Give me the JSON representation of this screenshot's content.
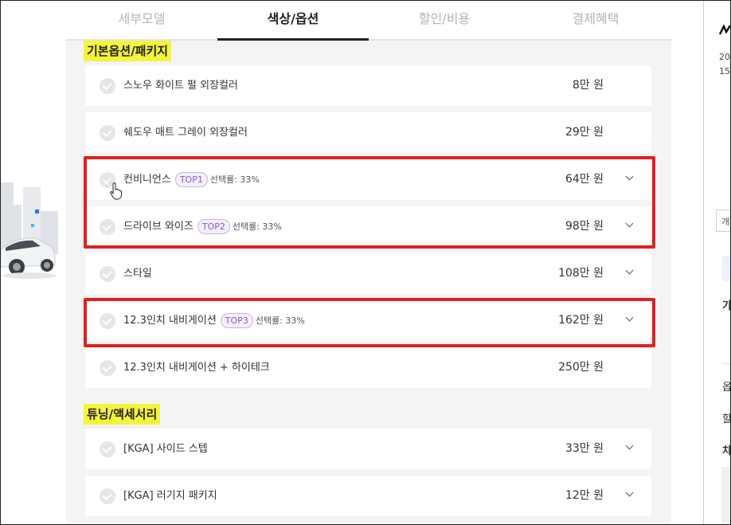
{
  "tabs": [
    {
      "label": "세부모델",
      "active": false
    },
    {
      "label": "색상/옵션",
      "active": true
    },
    {
      "label": "할인/비용",
      "active": false
    },
    {
      "label": "결제혜택",
      "active": false
    }
  ],
  "sections": {
    "basic": {
      "label": "기본옵션/패키지"
    },
    "tuning": {
      "label": "튜닝/액세서리"
    }
  },
  "options": [
    {
      "name": "스노우 화이트 펄 외장컬러",
      "price": "8만 원"
    },
    {
      "name": "쉐도우 매트 그레이 외장컬러",
      "price": "29만 원"
    },
    {
      "name": "컨비니언스",
      "badge": "TOP1",
      "rate": "선택률: 33%",
      "price": "64만 원"
    },
    {
      "name": "드라이브 와이즈",
      "badge": "TOP2",
      "rate": "선택률: 33%",
      "price": "98만 원"
    },
    {
      "name": "스타일",
      "price": "108만 원"
    },
    {
      "name": "12.3인치 내비게이션",
      "badge": "TOP3",
      "rate": "선택률: 33%",
      "price": "162만 원"
    },
    {
      "name": "12.3인치 내비게이션 + 하이테크",
      "price": "250만 원"
    }
  ],
  "accessories": [
    {
      "name": "[KGA] 사이드 스텝",
      "price": "33만 원"
    },
    {
      "name": "[KGA] 러기지 패키지",
      "price": "12만 원"
    }
  ],
  "right": {
    "line1": "20",
    "line2": "15",
    "box": "개",
    "b1": "가",
    "b2": "옵",
    "b3": "할",
    "b4": "차"
  },
  "colors": {
    "highlight": "#e02020",
    "section_bg": "#f4f43c",
    "badge": "#8a5cc2"
  }
}
